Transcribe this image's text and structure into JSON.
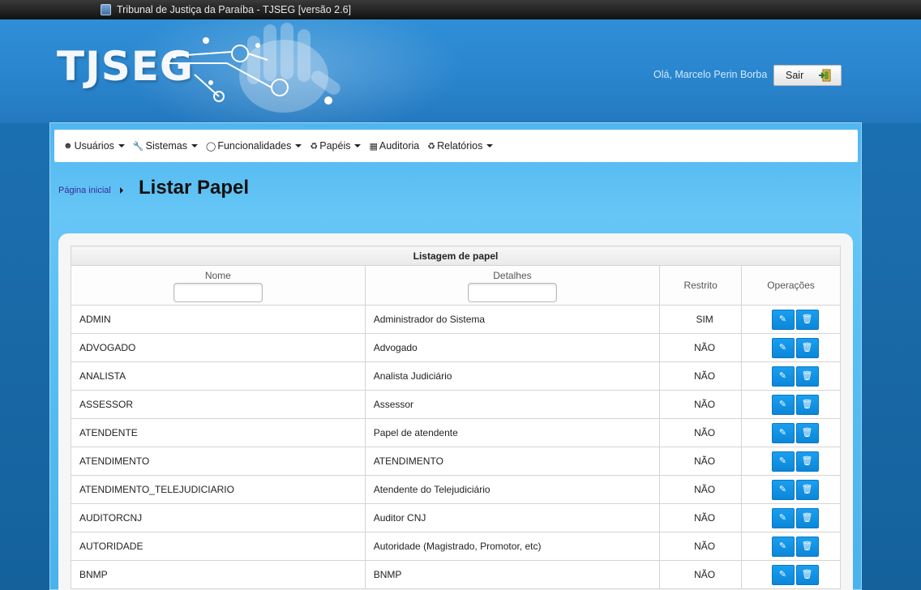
{
  "window": {
    "title": "Tribunal de Justiça da Paraíba - TJSEG [versão 2.6]"
  },
  "header": {
    "logo_text": "TJSEG",
    "greeting": "Olá, Marcelo Perin Borba",
    "logout_label": "Sair"
  },
  "nav": {
    "items": [
      {
        "label": "Usuários",
        "icon": "user-icon",
        "dropdown": true
      },
      {
        "label": "Sistemas",
        "icon": "wrench-icon",
        "dropdown": true
      },
      {
        "label": "Funcionalidades",
        "icon": "lightbulb-icon",
        "dropdown": true
      },
      {
        "label": "Papéis",
        "icon": "roles-icon",
        "dropdown": true
      },
      {
        "label": "Auditoria",
        "icon": "table-icon",
        "dropdown": false
      },
      {
        "label": "Relatórios",
        "icon": "report-icon",
        "dropdown": true
      }
    ]
  },
  "breadcrumb": {
    "home": "Página inicial"
  },
  "page": {
    "title": "Listar Papel"
  },
  "table": {
    "caption": "Listagem de papel",
    "columns": {
      "name": "Nome",
      "details": "Detalhes",
      "restricted": "Restrito",
      "operations": "Operações"
    },
    "rows": [
      {
        "name": "ADMIN",
        "details": "Administrador do Sistema",
        "restricted": "SIM"
      },
      {
        "name": "ADVOGADO",
        "details": "Advogado",
        "restricted": "NÃO"
      },
      {
        "name": "ANALISTA",
        "details": "Analista Judiciário",
        "restricted": "NÃO"
      },
      {
        "name": "ASSESSOR",
        "details": "Assessor",
        "restricted": "NÃO"
      },
      {
        "name": "ATENDENTE",
        "details": "Papel de atendente",
        "restricted": "NÃO"
      },
      {
        "name": "ATENDIMENTO",
        "details": "ATENDIMENTO",
        "restricted": "NÃO"
      },
      {
        "name": "ATENDIMENTO_TELEJUDICIARIO",
        "details": "Atendente do Telejudiciário",
        "restricted": "NÃO"
      },
      {
        "name": "AUDITORCNJ",
        "details": "Auditor CNJ",
        "restricted": "NÃO"
      },
      {
        "name": "AUTORIDADE",
        "details": "Autoridade (Magistrado, Promotor, etc)",
        "restricted": "NÃO"
      },
      {
        "name": "BNMP",
        "details": "BNMP",
        "restricted": "NÃO"
      }
    ]
  },
  "colors": {
    "accent_button": "#0b86d8",
    "panel": "#59bff3",
    "header": "#2a86cf"
  }
}
